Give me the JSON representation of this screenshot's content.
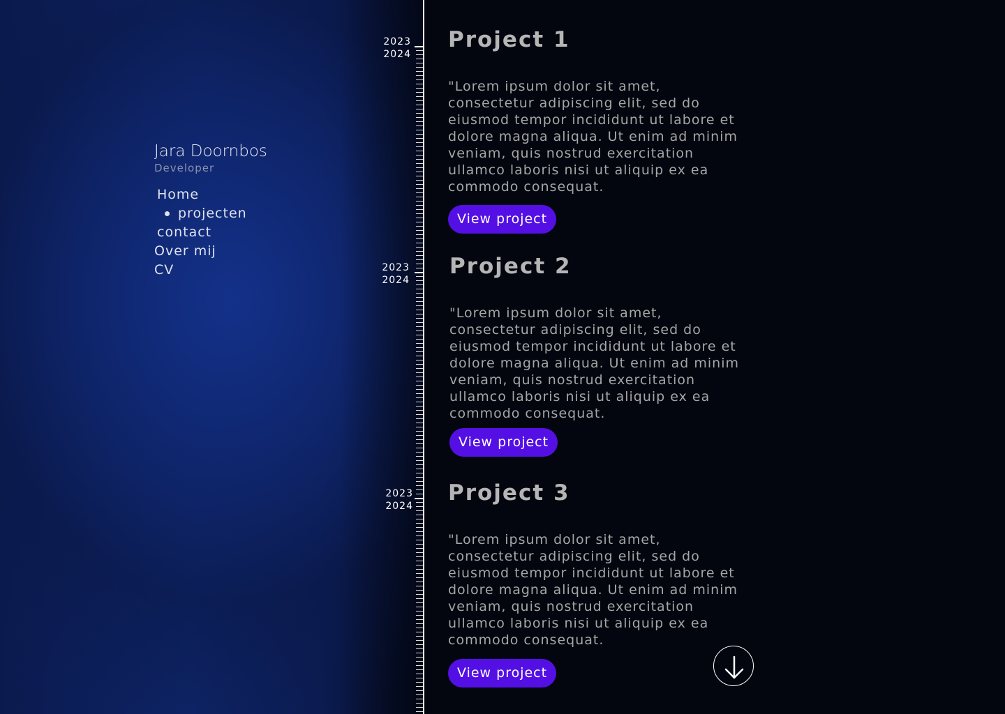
{
  "profile": {
    "name": "Jara Doornbos",
    "role": "Developer"
  },
  "nav": {
    "home": "Home",
    "projects": "projecten",
    "contact": "contact",
    "about": "Over mij",
    "cv": "CV"
  },
  "timeline": {
    "markers": [
      {
        "start": "2023",
        "end": "2024"
      },
      {
        "start": "2023",
        "end": "2024"
      },
      {
        "start": "2023",
        "end": "2024"
      }
    ]
  },
  "projects": [
    {
      "title": "Project 1",
      "description": "\"Lorem ipsum dolor sit amet, consectetur adipiscing elit, sed do eiusmod tempor incididunt ut labore et dolore magna aliqua. Ut enim ad minim veniam, quis nostrud exercitation ullamco laboris nisi ut aliquip ex ea commodo consequat.",
      "button": "View project"
    },
    {
      "title": "Project 2",
      "description": "\"Lorem ipsum dolor sit amet, consectetur adipiscing elit, sed do eiusmod tempor incididunt ut labore et dolore magna aliqua. Ut enim ad minim veniam, quis nostrud exercitation ullamco laboris nisi ut aliquip ex ea commodo consequat.",
      "button": "View project"
    },
    {
      "title": "Project 3",
      "description": "\"Lorem ipsum dolor sit amet, consectetur adipiscing elit, sed do eiusmod tempor incididunt ut labore et dolore magna aliqua. Ut enim ad minim veniam, quis nostrud exercitation ullamco laboris nisi ut aliquip ex ea commodo consequat.",
      "button": "View project"
    }
  ],
  "colors": {
    "accent": "#5410e4",
    "background": "#03060f",
    "sidebar": "#0e2466"
  },
  "icons": {
    "scroll": "arrow-down-icon"
  }
}
